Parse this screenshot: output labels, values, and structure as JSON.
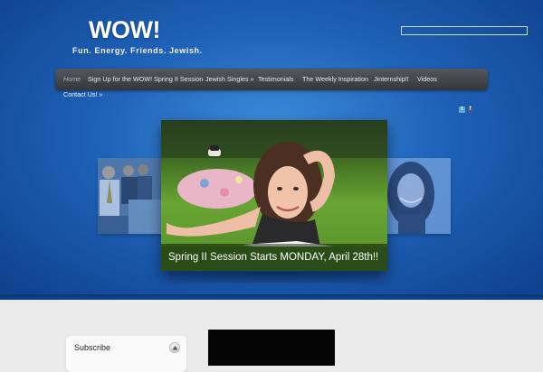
{
  "site": {
    "logo_word": "WOW!",
    "logo_tagline": "Fun.  Energy.  Friends.  Jewish."
  },
  "search": {
    "value": "",
    "placeholder": ""
  },
  "nav": {
    "items": [
      {
        "label": "Home",
        "active": true
      },
      {
        "label": "Sign Up for the WOW! Spring II Session"
      },
      {
        "label": "Jewish Singles »"
      },
      {
        "label": "Testimonials"
      },
      {
        "label": "The Weekly Inspiration"
      },
      {
        "label": "Jinternship!!"
      },
      {
        "label": "Videos"
      },
      {
        "label": "Contact Us! »"
      }
    ]
  },
  "social": {
    "twitter_icon": "t",
    "facebook_icon": "f",
    "colors": {
      "twitter": "#5aa9d6",
      "facebook": "#3b5998"
    }
  },
  "slider": {
    "caption": "Spring II Session Starts MONDAY, April 28th!!"
  },
  "sidebar": {
    "widget_title": "Subscribe"
  },
  "colors": {
    "hero_accent": "#1f62b8",
    "nav_bg": "#45484d",
    "page_bg": "#ebebeb"
  }
}
